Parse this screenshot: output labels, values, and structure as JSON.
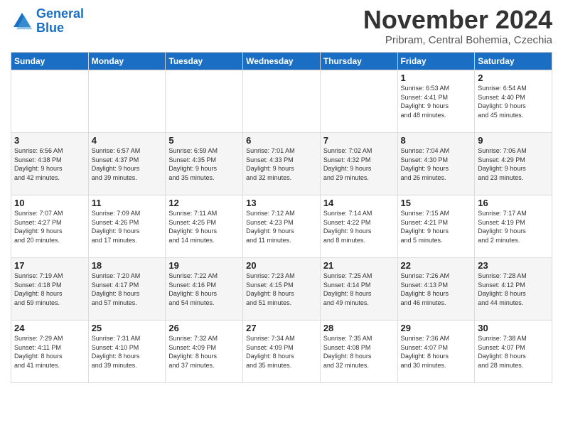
{
  "logo": {
    "line1": "General",
    "line2": "Blue"
  },
  "title": "November 2024",
  "location": "Pribram, Central Bohemia, Czechia",
  "weekdays": [
    "Sunday",
    "Monday",
    "Tuesday",
    "Wednesday",
    "Thursday",
    "Friday",
    "Saturday"
  ],
  "weeks": [
    [
      {
        "day": "",
        "info": ""
      },
      {
        "day": "",
        "info": ""
      },
      {
        "day": "",
        "info": ""
      },
      {
        "day": "",
        "info": ""
      },
      {
        "day": "",
        "info": ""
      },
      {
        "day": "1",
        "info": "Sunrise: 6:53 AM\nSunset: 4:41 PM\nDaylight: 9 hours\nand 48 minutes."
      },
      {
        "day": "2",
        "info": "Sunrise: 6:54 AM\nSunset: 4:40 PM\nDaylight: 9 hours\nand 45 minutes."
      }
    ],
    [
      {
        "day": "3",
        "info": "Sunrise: 6:56 AM\nSunset: 4:38 PM\nDaylight: 9 hours\nand 42 minutes."
      },
      {
        "day": "4",
        "info": "Sunrise: 6:57 AM\nSunset: 4:37 PM\nDaylight: 9 hours\nand 39 minutes."
      },
      {
        "day": "5",
        "info": "Sunrise: 6:59 AM\nSunset: 4:35 PM\nDaylight: 9 hours\nand 35 minutes."
      },
      {
        "day": "6",
        "info": "Sunrise: 7:01 AM\nSunset: 4:33 PM\nDaylight: 9 hours\nand 32 minutes."
      },
      {
        "day": "7",
        "info": "Sunrise: 7:02 AM\nSunset: 4:32 PM\nDaylight: 9 hours\nand 29 minutes."
      },
      {
        "day": "8",
        "info": "Sunrise: 7:04 AM\nSunset: 4:30 PM\nDaylight: 9 hours\nand 26 minutes."
      },
      {
        "day": "9",
        "info": "Sunrise: 7:06 AM\nSunset: 4:29 PM\nDaylight: 9 hours\nand 23 minutes."
      }
    ],
    [
      {
        "day": "10",
        "info": "Sunrise: 7:07 AM\nSunset: 4:27 PM\nDaylight: 9 hours\nand 20 minutes."
      },
      {
        "day": "11",
        "info": "Sunrise: 7:09 AM\nSunset: 4:26 PM\nDaylight: 9 hours\nand 17 minutes."
      },
      {
        "day": "12",
        "info": "Sunrise: 7:11 AM\nSunset: 4:25 PM\nDaylight: 9 hours\nand 14 minutes."
      },
      {
        "day": "13",
        "info": "Sunrise: 7:12 AM\nSunset: 4:23 PM\nDaylight: 9 hours\nand 11 minutes."
      },
      {
        "day": "14",
        "info": "Sunrise: 7:14 AM\nSunset: 4:22 PM\nDaylight: 9 hours\nand 8 minutes."
      },
      {
        "day": "15",
        "info": "Sunrise: 7:15 AM\nSunset: 4:21 PM\nDaylight: 9 hours\nand 5 minutes."
      },
      {
        "day": "16",
        "info": "Sunrise: 7:17 AM\nSunset: 4:19 PM\nDaylight: 9 hours\nand 2 minutes."
      }
    ],
    [
      {
        "day": "17",
        "info": "Sunrise: 7:19 AM\nSunset: 4:18 PM\nDaylight: 8 hours\nand 59 minutes."
      },
      {
        "day": "18",
        "info": "Sunrise: 7:20 AM\nSunset: 4:17 PM\nDaylight: 8 hours\nand 57 minutes."
      },
      {
        "day": "19",
        "info": "Sunrise: 7:22 AM\nSunset: 4:16 PM\nDaylight: 8 hours\nand 54 minutes."
      },
      {
        "day": "20",
        "info": "Sunrise: 7:23 AM\nSunset: 4:15 PM\nDaylight: 8 hours\nand 51 minutes."
      },
      {
        "day": "21",
        "info": "Sunrise: 7:25 AM\nSunset: 4:14 PM\nDaylight: 8 hours\nand 49 minutes."
      },
      {
        "day": "22",
        "info": "Sunrise: 7:26 AM\nSunset: 4:13 PM\nDaylight: 8 hours\nand 46 minutes."
      },
      {
        "day": "23",
        "info": "Sunrise: 7:28 AM\nSunset: 4:12 PM\nDaylight: 8 hours\nand 44 minutes."
      }
    ],
    [
      {
        "day": "24",
        "info": "Sunrise: 7:29 AM\nSunset: 4:11 PM\nDaylight: 8 hours\nand 41 minutes."
      },
      {
        "day": "25",
        "info": "Sunrise: 7:31 AM\nSunset: 4:10 PM\nDaylight: 8 hours\nand 39 minutes."
      },
      {
        "day": "26",
        "info": "Sunrise: 7:32 AM\nSunset: 4:09 PM\nDaylight: 8 hours\nand 37 minutes."
      },
      {
        "day": "27",
        "info": "Sunrise: 7:34 AM\nSunset: 4:09 PM\nDaylight: 8 hours\nand 35 minutes."
      },
      {
        "day": "28",
        "info": "Sunrise: 7:35 AM\nSunset: 4:08 PM\nDaylight: 8 hours\nand 32 minutes."
      },
      {
        "day": "29",
        "info": "Sunrise: 7:36 AM\nSunset: 4:07 PM\nDaylight: 8 hours\nand 30 minutes."
      },
      {
        "day": "30",
        "info": "Sunrise: 7:38 AM\nSunset: 4:07 PM\nDaylight: 8 hours\nand 28 minutes."
      }
    ]
  ]
}
